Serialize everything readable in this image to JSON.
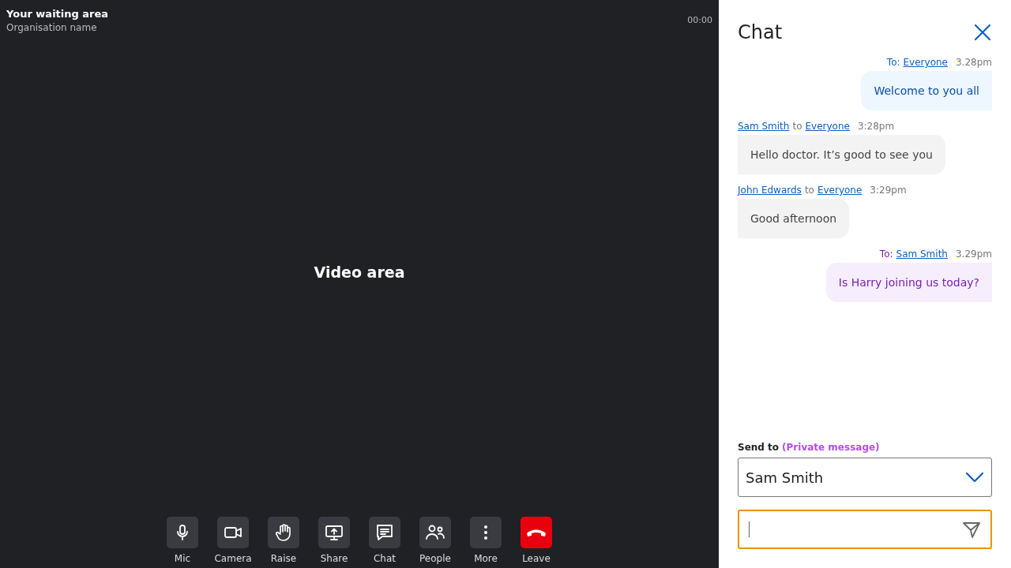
{
  "meeting": {
    "title": "Your waiting area",
    "subtitle": "Organisation name",
    "timer": "00:00"
  },
  "video": {
    "label": "Video area"
  },
  "toolbar": [
    {
      "kind": "mic",
      "label": "Mic"
    },
    {
      "kind": "camera",
      "label": "Camera"
    },
    {
      "kind": "raise",
      "label": "Raise"
    },
    {
      "kind": "share",
      "label": "Share"
    },
    {
      "kind": "chat",
      "label": "Chat"
    },
    {
      "kind": "people",
      "label": "People"
    },
    {
      "kind": "more",
      "label": "More"
    },
    {
      "kind": "leave",
      "label": "Leave"
    }
  ],
  "chat": {
    "title": "Chat",
    "messages": [
      {
        "kind": "sent-public",
        "prefix": "To:",
        "recipient": "Everyone",
        "time": "3.28pm",
        "text": "Welcome to you all"
      },
      {
        "kind": "received",
        "sender": "Sam Smith",
        "connector": "to",
        "recipient": "Everyone",
        "time": "3:28pm",
        "text": "Hello doctor. It’s good to see you"
      },
      {
        "kind": "received",
        "sender": "John Edwards",
        "connector": "to",
        "recipient": "Everyone",
        "time": "3:29pm",
        "text": "Good afternoon"
      },
      {
        "kind": "sent-private",
        "prefix": "To:",
        "recipient": "Sam Smith",
        "time": "3.29pm",
        "text": "Is Harry joining us today?"
      }
    ],
    "send_to": {
      "label": "Send to",
      "note": "(Private message)",
      "value": "Sam Smith"
    },
    "message_field": {
      "focused": true
    }
  }
}
